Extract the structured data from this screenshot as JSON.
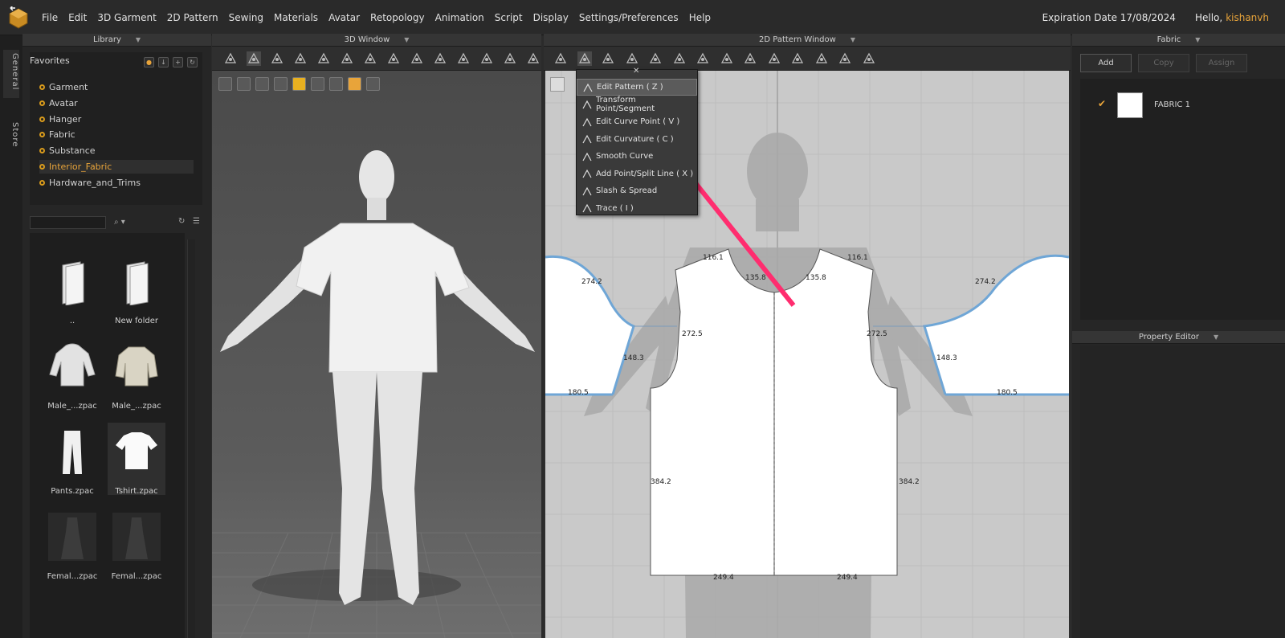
{
  "menubar": {
    "items": [
      "File",
      "Edit",
      "3D Garment",
      "2D Pattern",
      "Sewing",
      "Materials",
      "Avatar",
      "Retopology",
      "Animation",
      "Script",
      "Display",
      "Settings/Preferences",
      "Help"
    ],
    "expiration": "Expiration Date 17/08/2024",
    "greeting": "Hello,",
    "username": "kishanvh"
  },
  "side_tabs": [
    "General",
    "Store"
  ],
  "library": {
    "title": "Library",
    "favorites_title": "Favorites",
    "favorites": [
      "Garment",
      "Avatar",
      "Hanger",
      "Fabric",
      "Substance",
      "Interior_Fabric",
      "Hardware_and_Trims"
    ],
    "selected_favorite": "Interior_Fabric",
    "thumbs": [
      {
        "label": "..",
        "icon": "folder-icon"
      },
      {
        "label": "New folder",
        "icon": "folder-icon"
      },
      {
        "label": "Male_...zpac",
        "icon": "hoodie-icon"
      },
      {
        "label": "Male_...zpac",
        "icon": "puffer-jacket-icon"
      },
      {
        "label": "Pants.zpac",
        "icon": "pants-icon"
      },
      {
        "label": "Tshirt.zpac",
        "icon": "tshirt-icon"
      },
      {
        "label": "Femal...zpac",
        "icon": "dress-icon"
      },
      {
        "label": "Femal...zpac",
        "icon": "dress-icon"
      }
    ]
  },
  "window3d": {
    "title": "3D Window"
  },
  "window2d": {
    "title": "2D Pattern Window",
    "measurements": {
      "m1": "116.1",
      "m2": "116.1",
      "m3": "135.8",
      "m4": "135.8",
      "m5": "274.2",
      "m6": "274.2",
      "m7": "272.5",
      "m8": "272.5",
      "m9": "148.3",
      "m10": "148.3",
      "m11": "180.5",
      "m12": "180.5",
      "m13": "384.2",
      "m14": "384.2",
      "m15": "249.4",
      "m16": "249.4"
    }
  },
  "popup": {
    "items": [
      {
        "label": "Edit Pattern ( Z )",
        "icon": "edit-pattern-icon"
      },
      {
        "label": "Transform Point/Segment",
        "icon": "transform-icon"
      },
      {
        "label": "Edit Curve Point ( V )",
        "icon": "curve-point-icon"
      },
      {
        "label": "Edit Curvature ( C )",
        "icon": "curvature-icon"
      },
      {
        "label": "Smooth Curve",
        "icon": "smooth-curve-icon"
      },
      {
        "label": "Add Point/Split Line ( X )",
        "icon": "add-point-icon"
      },
      {
        "label": "Slash & Spread",
        "icon": "slash-spread-icon"
      },
      {
        "label": "Trace ( I )",
        "icon": "trace-icon"
      }
    ],
    "active_index": 0
  },
  "fabric_panel": {
    "title": "Fabric",
    "buttons": {
      "add": "Add",
      "copy": "Copy",
      "assign": "Assign"
    },
    "fabric_name": "FABRIC 1"
  },
  "property_editor": {
    "title": "Property Editor"
  },
  "colors": {
    "accent": "#e8a43a",
    "arrow": "#ff2d6f",
    "pattern_outline": "#6fa6d6"
  }
}
